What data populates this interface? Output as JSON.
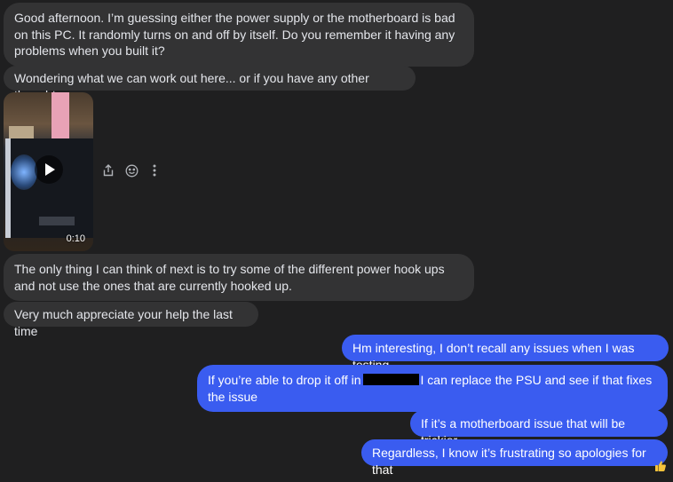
{
  "messages": {
    "m1": "Good afternoon. I’m guessing either the power supply or the motherboard is bad on this PC. It randomly turns on and off by itself. Do you remember it having any problems when you built it?",
    "m2": "Wondering what we can work out here... or if you have any other thoughts",
    "video_duration": "0:10",
    "m3": "The only thing I can think of next is to try some of the different power hook ups and not use the ones that are currently hooked up.",
    "m4": "Very much appreciate your help the last time",
    "o1": "Hm interesting, I don’t recall any issues when I was testing",
    "o2_before": "If you’re able to drop it off in",
    "o2_after": "I can replace the PSU and see if that fixes the issue",
    "o3": "If it’s a motherboard issue that will be trickier",
    "o4": "Regardless, I know it’s frustrating so apologies for that"
  },
  "icons": {
    "share": "share-icon",
    "react": "emoji-react-icon",
    "more": "more-options-icon",
    "reaction": "thumbs-up-reaction"
  },
  "colors": {
    "background": "#1f1f20",
    "incoming": "#333334",
    "outgoing": "#3a5cf0"
  }
}
